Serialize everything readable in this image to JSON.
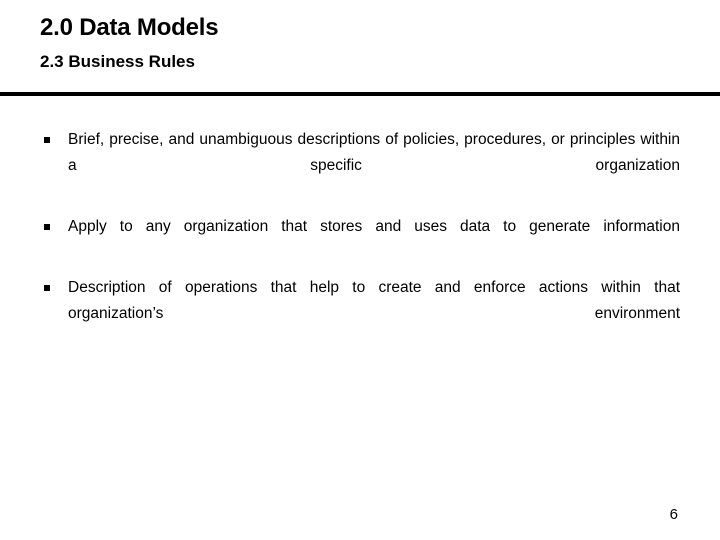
{
  "slide": {
    "title": "2.0 Data Models",
    "subtitle": "2.3 Business Rules",
    "page_number": "6",
    "bullet_marker_glyph": "square-bullet",
    "divider_color": "#000000",
    "text_color": "#000000",
    "background_color": "#ffffff",
    "bullets": [
      {
        "text": "Brief, precise, and unambiguous descriptions of policies, procedures, or principles within a specific organization"
      },
      {
        "text": "Apply to any organization that stores and uses data to generate information"
      },
      {
        "text": "Description of operations that help to create and enforce actions within that organization’s environment"
      }
    ]
  }
}
